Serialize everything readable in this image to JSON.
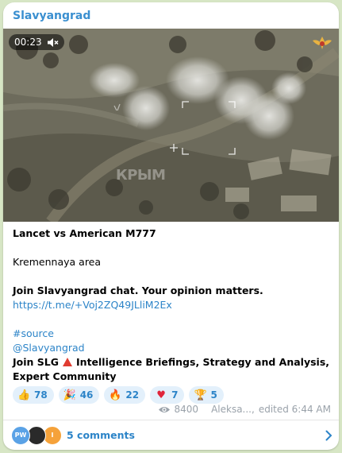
{
  "post": {
    "channel_name": "Slavyangrad",
    "video": {
      "duration": "00:23",
      "watermark": "КРЫМ",
      "mute_icon": "speaker-muted-icon"
    },
    "title": "Lancet vs American M777",
    "location": "Kremennaya area",
    "join_chat_text": "Join Slavyangrad chat. Your opinion matters.",
    "chat_link": "https://t.me/+Voj2ZQ49JLliM2Ex",
    "hashtag": "#source",
    "mention": "@Slavyangrad",
    "join_slg_prefix": "Join SLG",
    "join_slg_suffix": "Intelligence Briefings, Strategy and Analysis, Expert Community",
    "reactions": [
      {
        "emoji": "👍",
        "icon": "thumbs-up-icon",
        "count": "78"
      },
      {
        "emoji": "🎉",
        "icon": "party-popper-icon",
        "count": "46"
      },
      {
        "emoji": "🔥",
        "icon": "fire-icon",
        "count": "22"
      },
      {
        "emoji": "♥",
        "icon": "heart-icon",
        "count": "7"
      },
      {
        "emoji": "🏆",
        "icon": "trophy-icon",
        "count": "5"
      }
    ],
    "views": "8400",
    "author": "Aleksa...,",
    "edited_label": "edited 6:44 AM",
    "comments_label": "5 comments",
    "comment_avatars": [
      "PW",
      "",
      "I"
    ]
  },
  "colors": {
    "accent": "#2c84c8",
    "chat_background": "#d7e6c5",
    "reaction_bg": "#e3f0fb"
  }
}
